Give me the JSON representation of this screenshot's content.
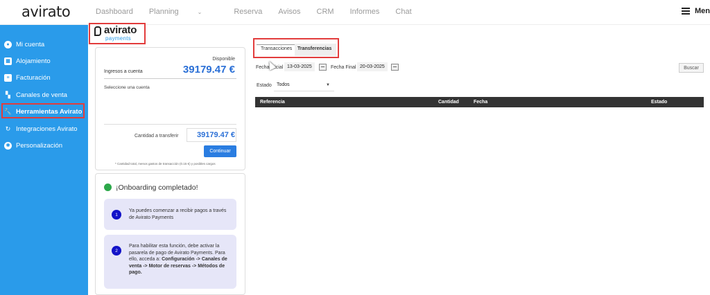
{
  "header": {
    "logo": "avirato",
    "nav": [
      "Dashboard",
      "Planning",
      "Reserva",
      "Avisos",
      "CRM",
      "Informes",
      "Chat"
    ],
    "menu_label": "Menú"
  },
  "sidebar": {
    "items": [
      {
        "label": "Mi cuenta",
        "icon": "user-icon"
      },
      {
        "label": "Alojamiento",
        "icon": "building-icon"
      },
      {
        "label": "Facturación",
        "icon": "invoice-icon"
      },
      {
        "label": "Canales de venta",
        "icon": "grid-icon"
      },
      {
        "label": "Herramientas Avirato",
        "icon": "wrench-icon"
      },
      {
        "label": "Integraciones Avirato",
        "icon": "sync-icon"
      },
      {
        "label": "Personalización",
        "icon": "gear-icon"
      }
    ]
  },
  "payments_logo": {
    "word": "avirato",
    "sub": "payments"
  },
  "transfer_card": {
    "available_label": "Disponible",
    "income_label": "Ingresos a cuenta",
    "income_value": "39179.47 €",
    "select_account_label": "Seleccione una cuenta",
    "amount_label": "Cantidad a transferir",
    "amount_value": "39179.47 €",
    "continue_label": "Continuar",
    "note": "* Cantidad total, menos gastos de transacción (0.15 €) y posibles cargos"
  },
  "onboarding": {
    "title": "¡Onboarding completado!",
    "steps": [
      {
        "num": "1",
        "text": "Ya puedes comenzar a recibir pagos a través de Avirato Payments"
      },
      {
        "num": "2",
        "text_plain": "Para habilitar esta función, debe activar la pasarela de pago de Avirato Payments. Para ello, acceda a: ",
        "text_bold": "Configuración -> Canales de venta -> Motor de reservas -> Métodos de pago."
      }
    ]
  },
  "tabs": [
    {
      "label": "Transacciones",
      "active": true
    },
    {
      "label": "Transferencias",
      "active": false
    }
  ],
  "filters": {
    "start_label": "Fecha Inicial",
    "start_value": "13-03-2025",
    "end_label": "Fecha Final",
    "end_value": "20-03-2025",
    "search_label": "Buscar",
    "status_label": "Estado",
    "status_value": "Todos"
  },
  "table": {
    "columns": [
      "Referencia",
      "Cantidad",
      "Fecha",
      "Estado"
    ]
  },
  "colors": {
    "sidebar": "#2a9bea",
    "highlight": "#e23c3c",
    "amount": "#2a6fd6",
    "button": "#2a7de1"
  }
}
